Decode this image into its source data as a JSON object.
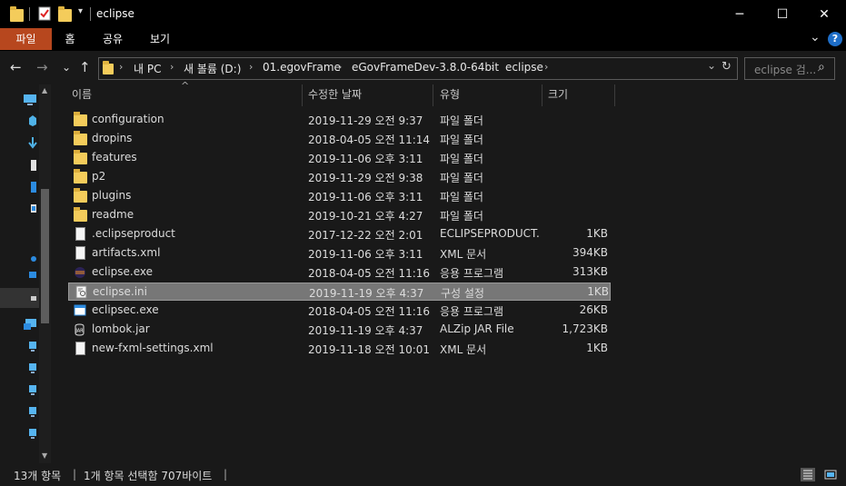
{
  "window": {
    "title": "eclipse",
    "minimize": "─",
    "maximize": "☐",
    "close": "✕"
  },
  "ribbon": {
    "tabs": [
      "파일",
      "홈",
      "공유",
      "보기"
    ],
    "expand": "⌄",
    "help": "?"
  },
  "nav": {
    "back": "←",
    "forward": "→",
    "recent": "⌄",
    "up": "↑",
    "breadcrumb": [
      "내 PC",
      "새 볼륨 (D:)",
      "01.egovFrame",
      "eGovFrameDev-3.8.0-64bit",
      "eclipse"
    ],
    "separator": "›",
    "dropdown": "⌄",
    "refresh": "↻",
    "search_placeholder": "eclipse 검...",
    "search_icon": "⌕"
  },
  "columns": {
    "name": "이름",
    "date": "수정한 날짜",
    "type": "유형",
    "size": "크기",
    "sort_indicator": "^"
  },
  "files": [
    {
      "name": "configuration",
      "date": "2019-11-29 오전 9:37",
      "type": "파일 폴더",
      "size": "",
      "icon": "folder-icon"
    },
    {
      "name": "dropins",
      "date": "2018-04-05 오전 11:14",
      "type": "파일 폴더",
      "size": "",
      "icon": "folder-icon"
    },
    {
      "name": "features",
      "date": "2019-11-06 오후 3:11",
      "type": "파일 폴더",
      "size": "",
      "icon": "folder-icon"
    },
    {
      "name": "p2",
      "date": "2019-11-29 오전 9:38",
      "type": "파일 폴더",
      "size": "",
      "icon": "folder-icon"
    },
    {
      "name": "plugins",
      "date": "2019-11-06 오후 3:11",
      "type": "파일 폴더",
      "size": "",
      "icon": "folder-icon"
    },
    {
      "name": "readme",
      "date": "2019-10-21 오후 4:27",
      "type": "파일 폴더",
      "size": "",
      "icon": "folder-icon"
    },
    {
      "name": ".eclipseproduct",
      "date": "2017-12-22 오전 2:01",
      "type": "ECLIPSEPRODUCT...",
      "size": "1KB",
      "icon": "file-icon"
    },
    {
      "name": "artifacts.xml",
      "date": "2019-11-06 오후 3:11",
      "type": "XML 문서",
      "size": "394KB",
      "icon": "file-icon"
    },
    {
      "name": "eclipse.exe",
      "date": "2018-04-05 오전 11:16",
      "type": "응용 프로그램",
      "size": "313KB",
      "icon": "eclipse-icon"
    },
    {
      "name": "eclipse.ini",
      "date": "2019-11-19 오후 4:37",
      "type": "구성 설정",
      "size": "1KB",
      "icon": "ini-icon"
    },
    {
      "name": "eclipsec.exe",
      "date": "2018-04-05 오전 11:16",
      "type": "응용 프로그램",
      "size": "26KB",
      "icon": "window-icon"
    },
    {
      "name": "lombok.jar",
      "date": "2019-11-19 오후 4:37",
      "type": "ALZip JAR File",
      "size": "1,723KB",
      "icon": "jar-icon"
    },
    {
      "name": "new-fxml-settings.xml",
      "date": "2019-11-18 오전 10:01",
      "type": "XML 문서",
      "size": "1KB",
      "icon": "file-icon"
    }
  ],
  "selected_index": 9,
  "status": {
    "count": "13개 항목",
    "selection": "1개 항목 선택함 707바이트"
  },
  "colors": {
    "accent_tab": "#b7471e",
    "folder": "#f4cc5b",
    "selected_row": "#777777",
    "background": "#191919"
  }
}
